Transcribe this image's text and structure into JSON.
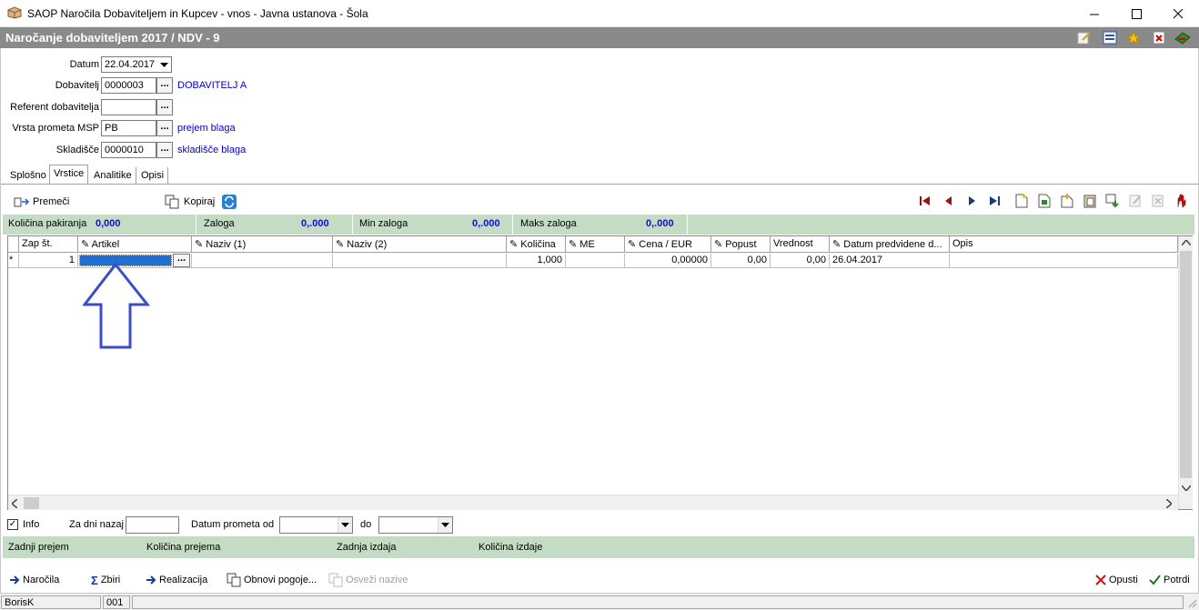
{
  "window": {
    "title": "SAOP  Naročila Dobaviteljem in Kupcev - vnos - Javna ustanova - Šola"
  },
  "form": {
    "title": "Naročanje dobaviteljem 2017 / NDV - 9"
  },
  "fields": {
    "datum": {
      "label": "Datum",
      "value": "22.04.2017"
    },
    "dobavitelj": {
      "label": "Dobavitelj",
      "value": "0000003",
      "desc": "DOBAVITELJ   A"
    },
    "referent": {
      "label": "Referent dobavitelja",
      "value": ""
    },
    "vrsta": {
      "label": "Vrsta prometa MSP",
      "value": "PB",
      "desc": "prejem blaga"
    },
    "skladisce": {
      "label": "Skladišče",
      "value": "0000010",
      "desc": "skladišče blaga"
    }
  },
  "tabs": [
    "Splošno",
    "Vrstice",
    "Analitike",
    "Opisi"
  ],
  "toolbar": {
    "premeci": "Premeči",
    "kopiraj": "Kopiraj"
  },
  "strip": {
    "kolicina_pak": {
      "label": "Količina pakiranja",
      "value": "0,000"
    },
    "zaloga": {
      "label": "Zaloga",
      "value": "0,.000"
    },
    "min_zaloga": {
      "label": "Min zaloga",
      "value": "0,.000"
    },
    "maks_zaloga": {
      "label": "Maks zaloga",
      "value": "0,.000"
    }
  },
  "grid": {
    "columns": [
      "Zap št.",
      "Artikel",
      "Naziv (1)",
      "Naziv (2)",
      "Količina",
      "ME",
      "Cena / EUR",
      "Popust",
      "Vrednost",
      "Datum predvidene d...",
      "Opis"
    ],
    "row": {
      "marker": "*",
      "zap": "1",
      "artikel": "",
      "naziv1": "",
      "naziv2": "",
      "kolicina": "1,000",
      "me": "",
      "cena": "0,00000",
      "popust": "0,00",
      "vrednost": "0,00",
      "datum": "26.04.2017",
      "opis": ""
    }
  },
  "filters": {
    "info": "Info",
    "info_checked": true,
    "za_dni_nazaj": "Za dni nazaj",
    "datum_od": "Datum prometa od",
    "do": "do"
  },
  "strip2": {
    "zadnji_prejem": "Zadnji prejem",
    "kolicina_prejema": "Količina prejema",
    "zadnja_izdaja": "Zadnja izdaja",
    "kolicina_izdaje": "Količina izdaje"
  },
  "buttons": {
    "narocila": "Naročila",
    "zbiri": "Zbiri",
    "realizacija": "Realizacija",
    "obnovi": "Obnovi pogoje...",
    "osvezi": "Osveži nazive",
    "opusti": "Opusti",
    "potrdi": "Potrdi"
  },
  "status": {
    "user": "BorisK",
    "code": "001"
  },
  "colors": {
    "accent": "#0000cc",
    "strip": "#c4dcc4",
    "header": "#8a8a8a",
    "selection": "#1f6fd1",
    "arrow": "#3a4cc8"
  }
}
